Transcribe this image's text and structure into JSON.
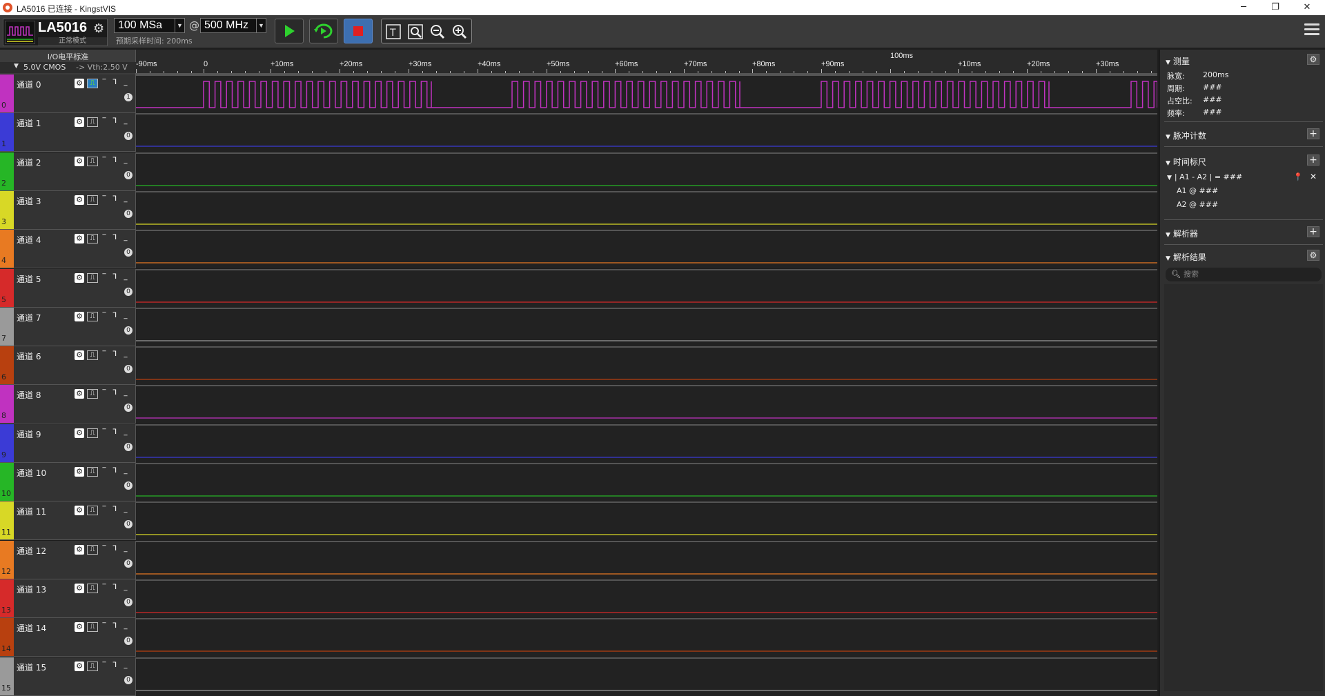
{
  "window": {
    "title": "LA5016 已连接 - KingstVIS",
    "minimize": "─",
    "maximize": "❐",
    "close": "✕"
  },
  "toolbar": {
    "device_name": "LA5016",
    "device_mode": "正常模式",
    "sample_depth": "100 MSa",
    "at": "@",
    "sample_rate": "500 MHz",
    "expected_time": "预期采样时间: 200ms"
  },
  "io": {
    "title": "I/O电平标准",
    "standard": "5.0V CMOS",
    "vth": "-> Vth:2.50 V"
  },
  "ruler": {
    "labels": [
      "-90ms",
      "0",
      "+10ms",
      "+20ms",
      "+30ms",
      "+40ms",
      "+50ms",
      "+60ms",
      "+70ms",
      "+80ms",
      "+90ms",
      "+10ms",
      "+20ms",
      "+30ms"
    ],
    "major": "100ms"
  },
  "channels": [
    {
      "label": "通道 0",
      "num": "0",
      "color": "#c032c0",
      "count": "1"
    },
    {
      "label": "通道 1",
      "num": "1",
      "color": "#3b3bd6",
      "count": "0"
    },
    {
      "label": "通道 2",
      "num": "2",
      "color": "#26b626",
      "count": "0"
    },
    {
      "label": "通道 3",
      "num": "3",
      "color": "#d8d826",
      "count": "0"
    },
    {
      "label": "通道 4",
      "num": "4",
      "color": "#e87a22",
      "count": "0"
    },
    {
      "label": "通道 5",
      "num": "5",
      "color": "#d62a2a",
      "count": "0"
    },
    {
      "label": "通道 7",
      "num": "7",
      "color": "#9a9a9a",
      "count": "0"
    },
    {
      "label": "通道 6",
      "num": "6",
      "color": "#b8400f",
      "count": "0"
    },
    {
      "label": "通道 8",
      "num": "8",
      "color": "#c032c0",
      "count": "0"
    },
    {
      "label": "通道 9",
      "num": "9",
      "color": "#3b3bd6",
      "count": "0"
    },
    {
      "label": "通道 10",
      "num": "10",
      "color": "#26b626",
      "count": "0"
    },
    {
      "label": "通道 11",
      "num": "11",
      "color": "#d8d826",
      "count": "0"
    },
    {
      "label": "通道 12",
      "num": "12",
      "color": "#e87a22",
      "count": "0"
    },
    {
      "label": "通道 13",
      "num": "13",
      "color": "#d62a2a",
      "count": "0"
    },
    {
      "label": "通道 14",
      "num": "14",
      "color": "#b8400f",
      "count": "0"
    },
    {
      "label": "通道 15",
      "num": "15",
      "color": "#9a9a9a",
      "count": "0"
    }
  ],
  "panel": {
    "measure": {
      "title": "测量",
      "rows": [
        {
          "k": "脉宽:",
          "v": "200ms"
        },
        {
          "k": "周期:",
          "v": "###"
        },
        {
          "k": "占空比:",
          "v": "###"
        },
        {
          "k": "频率:",
          "v": "###"
        }
      ]
    },
    "pulse_count": {
      "title": "脉冲计数"
    },
    "time_ruler": {
      "title": "时间标尺",
      "expr": "| A1 - A2 | = ###",
      "a1": "A1 @ ###",
      "a2": "A2 @ ###"
    },
    "analyzer": {
      "title": "解析器"
    },
    "results": {
      "title": "解析结果",
      "search_placeholder": "搜索"
    }
  }
}
